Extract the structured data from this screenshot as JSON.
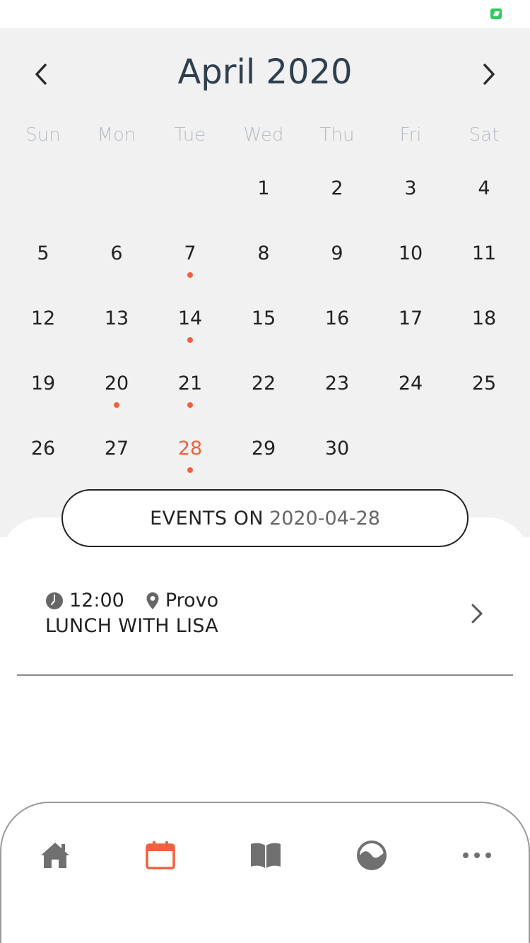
{
  "colors": {
    "accent": "#f0613f",
    "status_green": "#2ecc5e",
    "panel_bg": "#f1f1f1",
    "title": "#2f3f4f",
    "icon_gray": "#707070"
  },
  "calendar": {
    "title": "April 2020",
    "weekdays": [
      "Sun",
      "Mon",
      "Tue",
      "Wed",
      "Thu",
      "Fri",
      "Sat"
    ],
    "first_weekday_index": 3,
    "days_in_month": 30,
    "selected_day": 28,
    "event_days": [
      7,
      14,
      20,
      21,
      28
    ],
    "icons": {
      "prev": "chevron-left-icon",
      "next": "chevron-right-icon"
    }
  },
  "events": {
    "header_label": "EVENTS ON",
    "header_date": "2020-04-28",
    "items": [
      {
        "time": "12:00",
        "location": "Provo",
        "title": "LUNCH WITH LISA"
      }
    ]
  },
  "tabbar": {
    "items": [
      {
        "name": "home",
        "icon": "home-icon",
        "active": false
      },
      {
        "name": "calendar",
        "icon": "calendar-icon",
        "active": true
      },
      {
        "name": "book",
        "icon": "book-icon",
        "active": false
      },
      {
        "name": "wave",
        "icon": "wave-icon",
        "active": false
      },
      {
        "name": "more",
        "icon": "more-icon",
        "active": false
      }
    ]
  }
}
